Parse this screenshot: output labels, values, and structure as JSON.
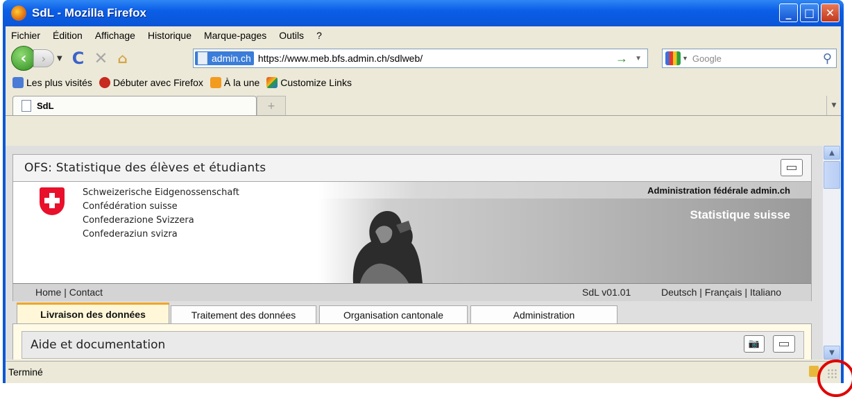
{
  "window": {
    "title": "SdL - Mozilla Firefox"
  },
  "menu": [
    "Fichier",
    "Édition",
    "Affichage",
    "Historique",
    "Marque-pages",
    "Outils",
    "?"
  ],
  "address": {
    "site_identity": "admin.ch",
    "url": "https://www.meb.bfs.admin.ch/sdlweb/"
  },
  "search": {
    "placeholder": "Google"
  },
  "bookmarks": [
    "Les plus visités",
    "Débuter avec Firefox",
    "À la une",
    "Customize Links"
  ],
  "tab": {
    "title": "SdL",
    "new_tab_glyph": "+"
  },
  "page": {
    "header_title": "OFS: Statistique des élèves et étudiants",
    "banner": {
      "languages_lines": [
        "Schweizerische Eidgenossenschaft",
        "Confédération suisse",
        "Confederazione Svizzera",
        "Confederaziun svizra"
      ],
      "admin": "Administration fédérale admin.ch",
      "statistique": "Statistique suisse"
    },
    "nav": {
      "home_contact": "Home | Contact",
      "version": "SdL v01.01",
      "languages": "Deutsch | Français | Italiano"
    },
    "tabs": [
      {
        "label": "Livraison des données",
        "active": true
      },
      {
        "label": "Traitement des données",
        "active": false
      },
      {
        "label": "Organisation cantonale",
        "active": false
      },
      {
        "label": "Administration",
        "active": false
      }
    ],
    "panel_title": "Aide et documentation"
  },
  "status": {
    "text": "Terminé"
  },
  "colors": {
    "titlebar": "#0a58d8",
    "active_tab_accent": "#f2a623",
    "highlight_circle": "#e00000"
  }
}
